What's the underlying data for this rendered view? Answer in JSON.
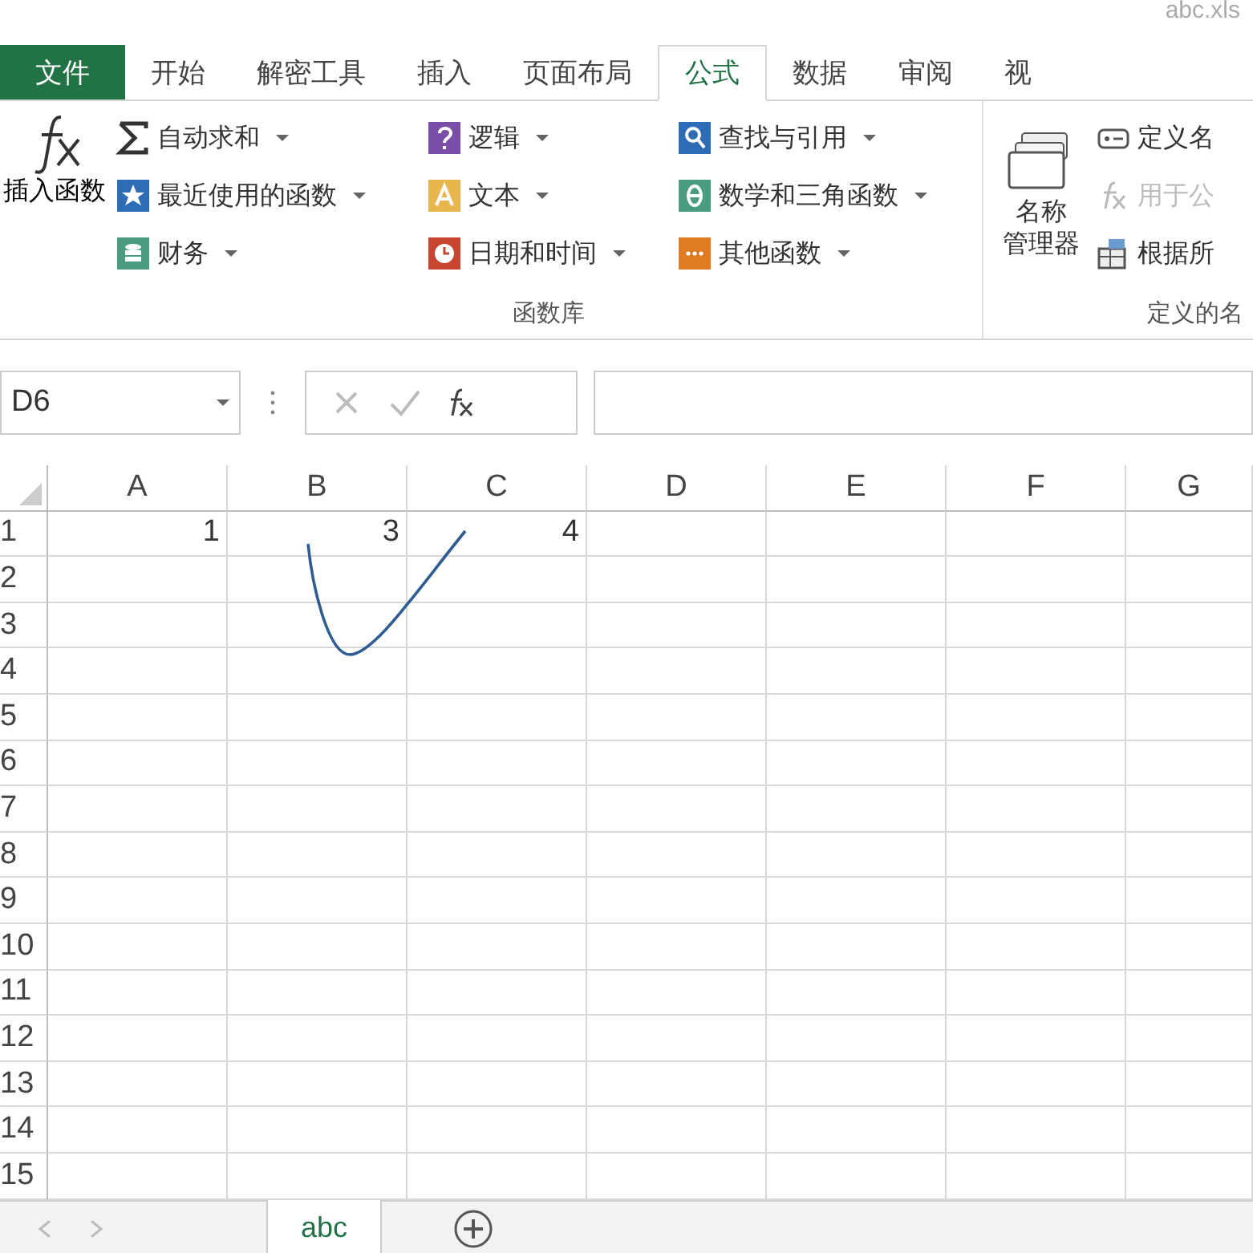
{
  "title": "abc.xls",
  "ribbon_tabs": [
    {
      "label": "文件",
      "kind": "file",
      "selected": false
    },
    {
      "label": "开始",
      "kind": "tab",
      "selected": false
    },
    {
      "label": "解密工具",
      "kind": "tab",
      "selected": false
    },
    {
      "label": "插入",
      "kind": "tab",
      "selected": false
    },
    {
      "label": "页面布局",
      "kind": "tab",
      "selected": false
    },
    {
      "label": "公式",
      "kind": "tab",
      "selected": true
    },
    {
      "label": "数据",
      "kind": "tab",
      "selected": false
    },
    {
      "label": "审阅",
      "kind": "tab",
      "selected": false
    },
    {
      "label": "视",
      "kind": "tab",
      "selected": false
    }
  ],
  "insert_function": {
    "label": "插入函数"
  },
  "function_library": {
    "title": "函数库",
    "columns": [
      [
        {
          "label": "自动求和",
          "kind": "sigma"
        },
        {
          "label": "最近使用的函数",
          "kind": "star"
        },
        {
          "label": "财务",
          "kind": "ledger"
        }
      ],
      [
        {
          "label": "逻辑",
          "kind": "question"
        },
        {
          "label": "文本",
          "kind": "letter"
        },
        {
          "label": "日期和时间",
          "kind": "clock"
        }
      ],
      [
        {
          "label": "查找与引用",
          "kind": "search"
        },
        {
          "label": "数学和三角函数",
          "kind": "theta"
        },
        {
          "label": "其他函数",
          "kind": "dots"
        }
      ]
    ]
  },
  "defined_names": {
    "title": "定义的名",
    "manager": [
      "名称",
      "管理器"
    ],
    "items": [
      {
        "label": "定义名",
        "kind": "tag",
        "disabled": false
      },
      {
        "label": "用于公",
        "kind": "fx",
        "disabled": true
      },
      {
        "label": "根据所",
        "kind": "grid",
        "disabled": false
      }
    ]
  },
  "formula_bar": {
    "name_box": "D6"
  },
  "columns": [
    "A",
    "B",
    "C",
    "D",
    "E",
    "F",
    "G"
  ],
  "rows": [
    {
      "number": "1",
      "cells": [
        "1",
        "3",
        "4"
      ]
    },
    {
      "number": "2",
      "cells": []
    },
    {
      "number": "3",
      "cells": []
    },
    {
      "number": "4",
      "cells": []
    },
    {
      "number": "5",
      "cells": []
    },
    {
      "number": "6",
      "cells": []
    },
    {
      "number": "7",
      "cells": []
    },
    {
      "number": "8",
      "cells": []
    },
    {
      "number": "9",
      "cells": []
    },
    {
      "number": "10",
      "cells": []
    },
    {
      "number": "11",
      "cells": []
    },
    {
      "number": "12",
      "cells": []
    },
    {
      "number": "13",
      "cells": []
    },
    {
      "number": "14",
      "cells": []
    },
    {
      "number": "15",
      "cells": []
    }
  ],
  "sheet_tabs": [
    {
      "label": "abc",
      "selected": true
    }
  ]
}
